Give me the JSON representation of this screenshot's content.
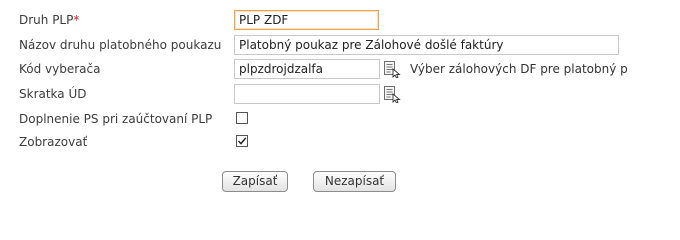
{
  "form": {
    "druh_plp": {
      "label": "Druh PLP",
      "required_mark": "*",
      "value": "PLP ZDF"
    },
    "nazov": {
      "label": "Názov druhu platobného poukazu",
      "value": "Platobný poukaz pre Zálohové došlé faktúry"
    },
    "kod_vyberaca": {
      "label": "Kód vyberača",
      "value": "plpzdrojdzalfa",
      "description": "Výber zálohových DF pre platobný p"
    },
    "skratka_ud": {
      "label": "Skratka ÚD",
      "value": ""
    },
    "doplnenie_ps": {
      "label": "Doplnenie PS pri zaúčtovaní PLP",
      "checked": false
    },
    "zobrazovat": {
      "label": "Zobrazovať",
      "checked": true
    }
  },
  "buttons": {
    "save": "Zapísať",
    "cancel": "Nezapísať"
  },
  "icons": {
    "lookup": "lookup-list-icon"
  },
  "colors": {
    "required": "#e0151b",
    "focus_border": "#f0a54a"
  }
}
